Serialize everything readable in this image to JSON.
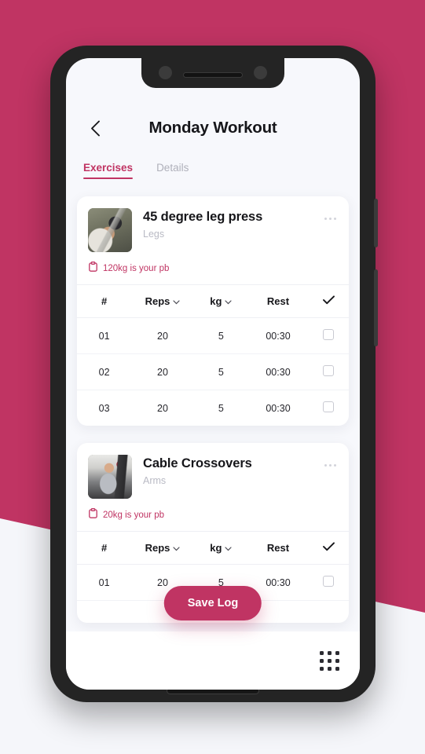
{
  "theme": {
    "accent": "#C03463",
    "background_pink": "#C03463",
    "background_light": "#F5F6FA",
    "screen_background": "#F7F8FC",
    "text_dark": "#16161A",
    "text_muted": "#B9BAC4"
  },
  "header": {
    "back_icon": "chevron-left-icon",
    "title": "Monday Workout"
  },
  "tabs": [
    {
      "label": "Exercises",
      "active": true
    },
    {
      "label": "Details",
      "active": false
    }
  ],
  "table_headers": {
    "number": "#",
    "reps": "Reps",
    "weight": "kg",
    "rest": "Rest",
    "done_icon": "check-icon"
  },
  "exercises": [
    {
      "name": "45 degree leg press",
      "muscle_group": "Legs",
      "thumbnail": "leg-press-photo",
      "pb_icon": "clipboard-icon",
      "pb_text": "120kg is your pb",
      "menu_icon": "ellipsis-icon",
      "sets": [
        {
          "number": "01",
          "reps": "20",
          "weight": "5",
          "rest": "00:30",
          "done": false
        },
        {
          "number": "02",
          "reps": "20",
          "weight": "5",
          "rest": "00:30",
          "done": false
        },
        {
          "number": "03",
          "reps": "20",
          "weight": "5",
          "rest": "00:30",
          "done": false
        }
      ]
    },
    {
      "name": "Cable Crossovers",
      "muscle_group": "Arms",
      "thumbnail": "cable-crossover-photo",
      "pb_icon": "clipboard-icon",
      "pb_text": "20kg is your pb",
      "menu_icon": "ellipsis-icon",
      "sets": [
        {
          "number": "01",
          "reps": "20",
          "weight": "5",
          "rest": "00:30",
          "done": false
        }
      ]
    }
  ],
  "save_button": {
    "label": "Save Log"
  },
  "bottom_bar": {
    "grid_icon": "grid-menu-icon"
  }
}
